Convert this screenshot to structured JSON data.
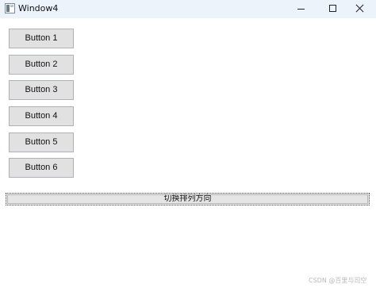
{
  "window": {
    "title": "Window4"
  },
  "buttons": [
    {
      "label": "Button 1"
    },
    {
      "label": "Button 2"
    },
    {
      "label": "Button 3"
    },
    {
      "label": "Button 4"
    },
    {
      "label": "Button 5"
    },
    {
      "label": "Button 6"
    }
  ],
  "toggle": {
    "label": "切换排列方向"
  },
  "watermark": {
    "text": "CSDN @百里与司空"
  },
  "icons": {
    "app": "app-window-icon",
    "minimize": "minimize-icon",
    "maximize": "maximize-icon",
    "close": "close-icon"
  },
  "colors": {
    "titlebar_background": "#edf3fa",
    "window_background": "#ffffff",
    "button_background": "#e1e1e1",
    "button_border": "#aeb2b7",
    "watermark_text": "#b9b9b9"
  }
}
